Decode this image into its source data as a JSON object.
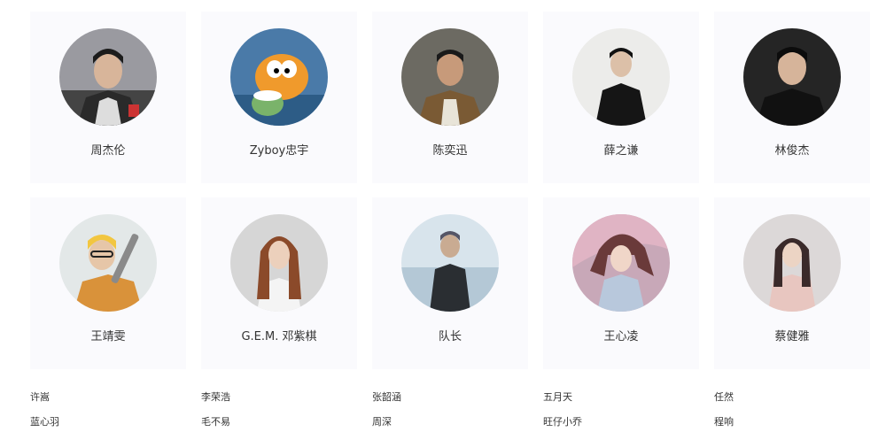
{
  "singers": [
    {
      "name": "周杰伦"
    },
    {
      "name": "Zyboy忠宇"
    },
    {
      "name": "陈奕迅"
    },
    {
      "name": "薛之谦"
    },
    {
      "name": "林俊杰"
    },
    {
      "name": "王靖雯"
    },
    {
      "name": "G.E.M. 邓紫棋"
    },
    {
      "name": "队长"
    },
    {
      "name": "王心凌"
    },
    {
      "name": "蔡健雅"
    }
  ],
  "text_list": [
    "许嵩",
    "李荣浩",
    "张韶涵",
    "五月天",
    "任然",
    "蓝心羽",
    "毛不易",
    "周深",
    "旺仔小乔",
    "程响"
  ]
}
